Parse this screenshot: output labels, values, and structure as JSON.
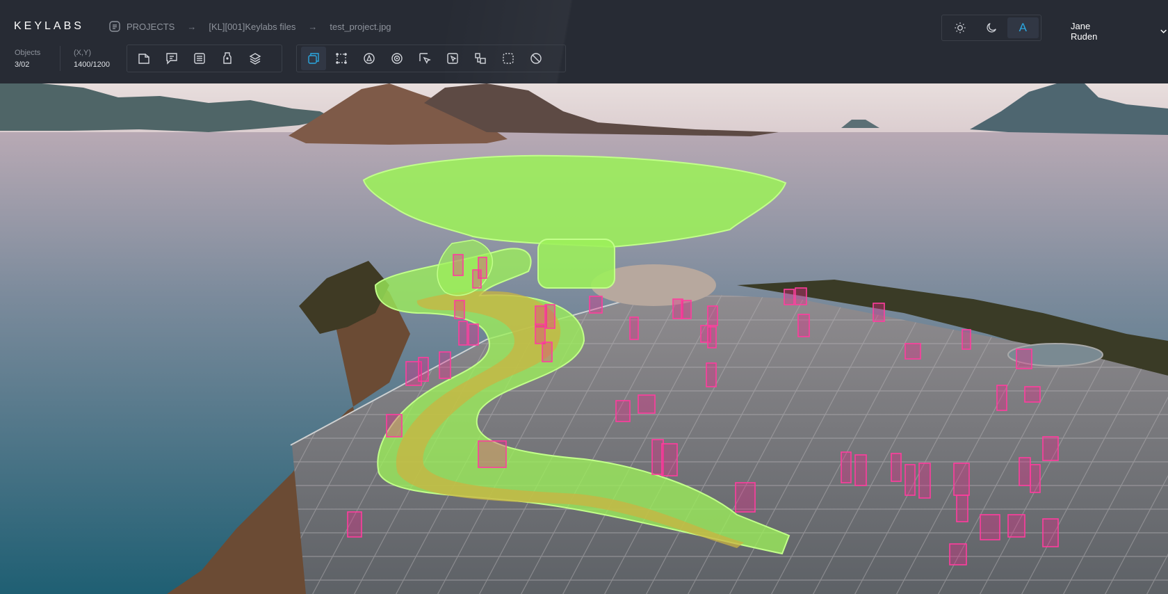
{
  "app": {
    "logo": "KEYLABS"
  },
  "breadcrumb": {
    "items": [
      "PROJECTS",
      "[KL][001]Keylabs files",
      "test_project.jpg"
    ],
    "separator": "→"
  },
  "stats": {
    "objects_label": "Objects",
    "objects_value": "3/02",
    "coords_label": "(X,Y)",
    "coords_value": "1400/1200"
  },
  "toolbar": {
    "group1": [
      "polygon-edit-icon",
      "comment-icon",
      "list-icon",
      "tag-icon",
      "layers-icon"
    ],
    "group2": [
      "bounding-box-icon",
      "keypoints-icon",
      "polygon-icon",
      "segment-icon",
      "cursor-select-icon",
      "click-select-icon",
      "cuboid-icon",
      "area-select-icon",
      "erase-icon"
    ],
    "active_tool": "bounding-box-icon"
  },
  "theme": {
    "options": [
      "sun-icon",
      "moon-icon",
      "auto-theme-icon"
    ],
    "active": "auto-theme-icon",
    "auto_glyph": "A"
  },
  "user": {
    "name": "Jane Ruden"
  },
  "colors": {
    "accent": "#2ba7e0",
    "segmentation": "#9cf05a",
    "bbox": "#e8258a",
    "topbar": "#272b34"
  }
}
